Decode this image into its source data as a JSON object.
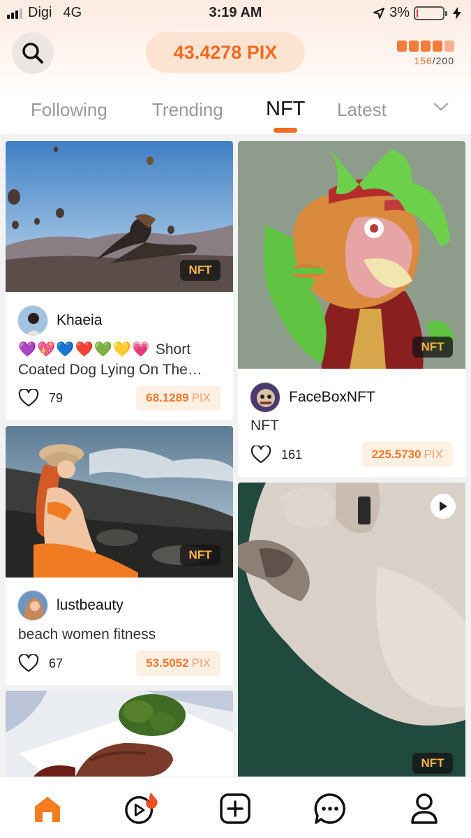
{
  "status_bar": {
    "carrier": "Digi",
    "network": "4G",
    "time": "3:19 AM",
    "battery": "3%",
    "battery_level": 0.03
  },
  "header": {
    "balance": "43.4278 PIX",
    "energy_current": "156",
    "energy_total": "/200"
  },
  "tabs": {
    "items": [
      "Following",
      "Trending",
      "NFT",
      "Latest"
    ],
    "active": "NFT"
  },
  "feed": {
    "nft_tag": "NFT",
    "posts": [
      {
        "username": "Khaeia",
        "hearts": "💜💖💙❤️💚💛💗",
        "description": "Short Coated Dog Lying On The Ground",
        "likes": "79",
        "price_value": "68.1289",
        "price_unit": "PIX"
      },
      {
        "username": "FaceBoxNFT",
        "description": "NFT",
        "likes": "161",
        "price_value": "225.5730",
        "price_unit": "PIX"
      },
      {
        "username": "lustbeauty",
        "description": "beach women fitness",
        "likes": "67",
        "price_value": "53.5052",
        "price_unit": "PIX"
      }
    ]
  },
  "colors": {
    "accent": "#f36b21",
    "price_bg": "#fff0e4",
    "balance_bg": "#fde3d2"
  },
  "nav": {
    "items": [
      "home-icon",
      "video-icon",
      "create-icon",
      "messages-icon",
      "profile-icon"
    ],
    "active": "home-icon"
  }
}
